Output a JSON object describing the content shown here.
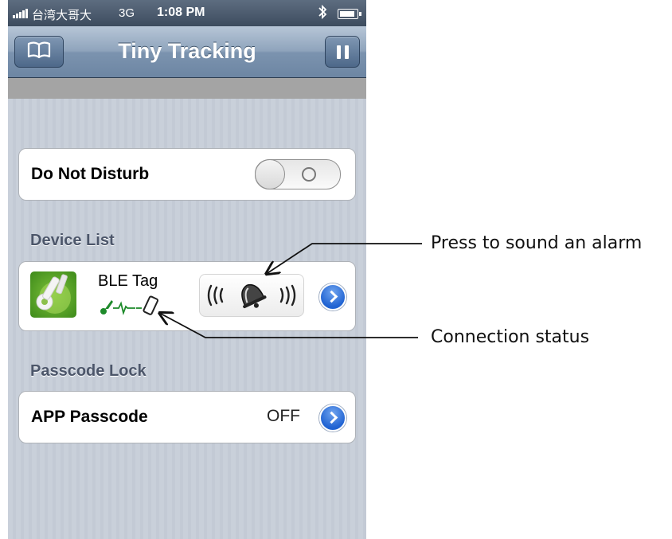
{
  "status_bar": {
    "carrier": "台湾大哥大",
    "network": "3G",
    "time": "1:08 PM",
    "bluetooth_icon": "bluetooth-icon",
    "battery_icon": "battery-icon"
  },
  "nav": {
    "title": "Tiny Tracking",
    "left_icon": "book-icon",
    "right_icon": "pause-icon"
  },
  "do_not_disturb": {
    "label": "Do Not Disturb",
    "toggle_on": false
  },
  "device_list": {
    "header": "Device List",
    "device": {
      "name": "BLE Tag",
      "icon": "key-tag-icon",
      "status_icons": [
        "key-icon",
        "signal-wave-icon",
        "phone-icon"
      ],
      "alarm_icon": "bell-alarm-icon"
    }
  },
  "passcode": {
    "header": "Passcode Lock",
    "label": "APP Passcode",
    "value": "OFF"
  },
  "annotations": {
    "alarm": "Press to sound an alarm",
    "connection": "Connection status"
  },
  "colors": {
    "nav_bar": "#7b93af",
    "section_header": "#4c566a",
    "disclosure": "#2063d2",
    "icon_green": "#3d8a1a"
  }
}
